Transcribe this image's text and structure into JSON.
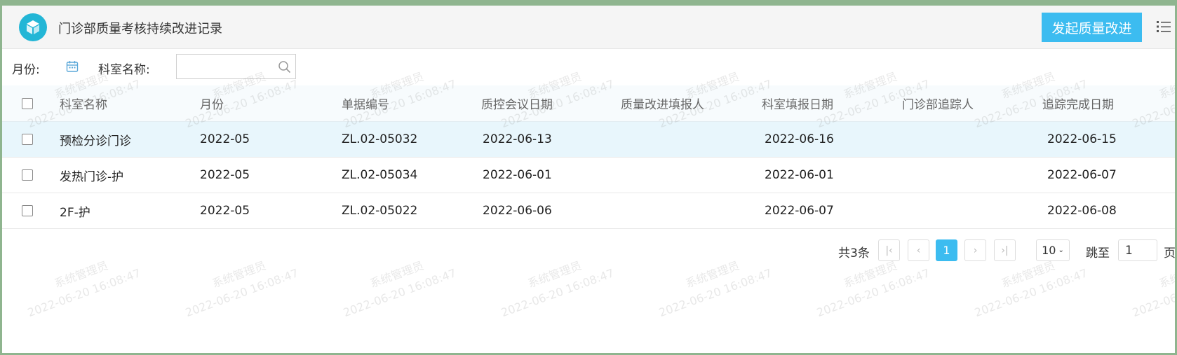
{
  "header": {
    "title": "门诊部质量考核持续改进记录",
    "primary_button": "发起质量改进",
    "logo_icon": "cube-icon",
    "menu_icon": "list-menu-icon"
  },
  "filters": {
    "month_label": "月份:",
    "dept_label": "科室名称:",
    "dept_value": "",
    "calendar_icon": "calendar-icon",
    "search_icon": "search-icon"
  },
  "table": {
    "columns": [
      "科室名称",
      "月份",
      "单据编号",
      "质控会议日期",
      "质量改进填报人",
      "科室填报日期",
      "门诊部追踪人",
      "追踪完成日期"
    ],
    "rows": [
      [
        "预检分诊门诊",
        "2022-05",
        "ZL.02-05032",
        "2022-06-13",
        "",
        "2022-06-16",
        "",
        "2022-06-15"
      ],
      [
        "发热门诊-护",
        "2022-05",
        "ZL.02-05034",
        "2022-06-01",
        "",
        "2022-06-01",
        "",
        "2022-06-07"
      ],
      [
        "2F-护",
        "2022-05",
        "ZL.02-05022",
        "2022-06-06",
        "",
        "2022-06-07",
        "",
        "2022-06-08"
      ]
    ]
  },
  "pagination": {
    "total": "共3条",
    "current": "1",
    "page_size": "10",
    "jump_label": "跳至",
    "jump_value": "1",
    "page_suffix": "页"
  },
  "watermark": {
    "name": "系统管理员",
    "time": "2022-06-20 16:08:47"
  },
  "colors": {
    "accent": "#3cbcf0",
    "logo": "#23b6d6",
    "row_highlight": "#e8f6fc"
  }
}
